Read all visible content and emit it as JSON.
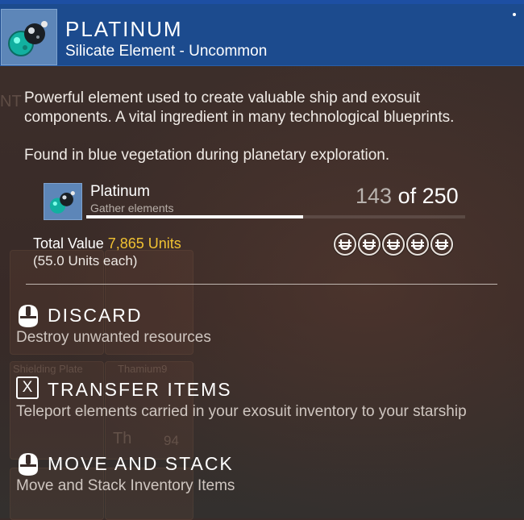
{
  "item": {
    "name": "PLATINUM",
    "subtitle": "Silicate Element - Uncommon",
    "description": "Powerful element used to create valuable ship and exosuit components. A vital ingredient in many technological blueprints.",
    "found": "Found in blue vegetation during planetary exploration.",
    "icon": "platinum-gem-icon"
  },
  "resource": {
    "name": "Platinum",
    "subtitle": "Gather elements",
    "current": "143",
    "of_label": " of 250",
    "progress": 0.572
  },
  "value": {
    "label": "Total Value ",
    "amount": "7,865 Units",
    "each": "(55.0 Units each)",
    "unit_icon_count": 5,
    "unit_icon": "units-currency-icon",
    "amount_color": "#f1c232"
  },
  "actions": [
    {
      "title": "DISCARD",
      "description": "Destroy unwanted resources",
      "icon": "mouse-button-icon"
    },
    {
      "title": "TRANSFER ITEMS",
      "description": "Teleport elements carried in your exosuit inventory to your starship",
      "key": "X",
      "icon": "x-key-icon"
    },
    {
      "title": "MOVE AND STACK",
      "description": "Move and Stack Inventory Items",
      "icon": "mouse-button-icon"
    }
  ],
  "background": {
    "ghost_labels": [
      "Shielding Plate",
      "Thamium9",
      "Th",
      "94",
      "NT"
    ]
  },
  "colors": {
    "header_bg": "#1c4b8e",
    "icon_box_bg": "#5d86b8",
    "panel_bg": "#3a2c29"
  }
}
